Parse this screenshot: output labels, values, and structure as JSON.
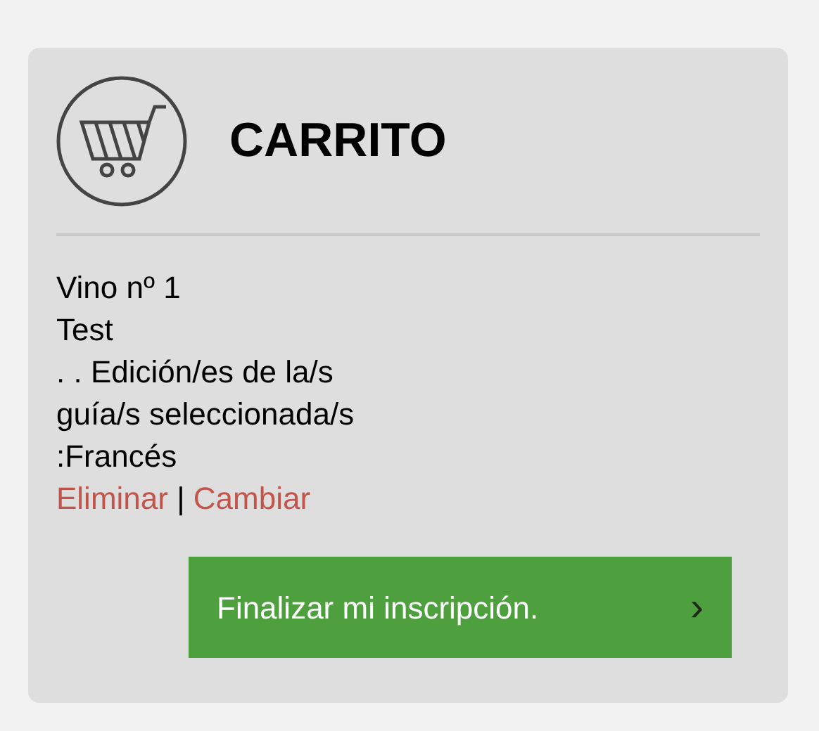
{
  "cart": {
    "title": "CARRITO",
    "lines": [
      "Vino nº 1",
      "Test",
      ". . Edición/es de la/s",
      "guía/s seleccionada/s",
      ":Francés"
    ],
    "actions": [
      {
        "label": "Eliminar"
      },
      {
        "label": "Cambiar"
      }
    ],
    "separator": "|",
    "checkout": {
      "label": "Finalizar mi inscripción.",
      "arrow": "›"
    }
  }
}
